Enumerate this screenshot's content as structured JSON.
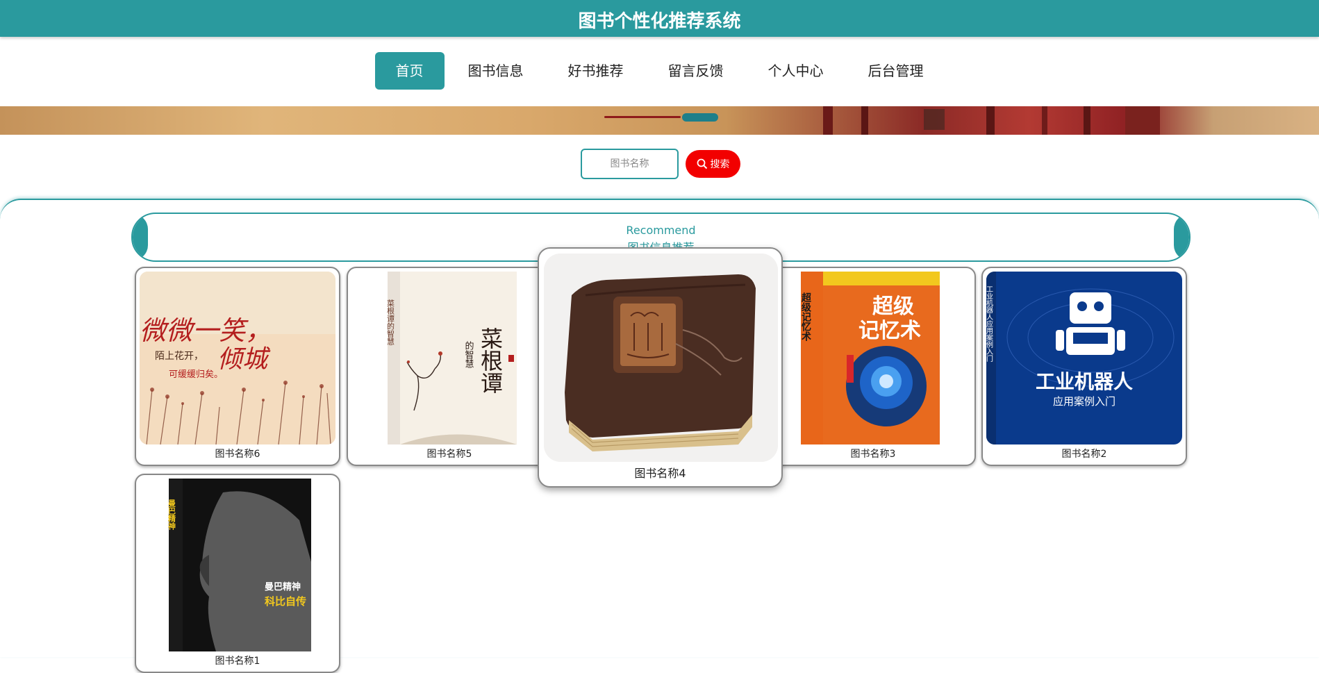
{
  "header": {
    "title": "图书个性化推荐系统"
  },
  "nav": {
    "items": [
      {
        "label": "首页",
        "active": true
      },
      {
        "label": "图书信息"
      },
      {
        "label": "好书推荐"
      },
      {
        "label": "留言反馈"
      },
      {
        "label": "个人中心"
      },
      {
        "label": "后台管理"
      }
    ]
  },
  "search": {
    "placeholder": "图书名称",
    "button_label": "搜索"
  },
  "recommend": {
    "title_en": "Recommend",
    "title_cn": "图书信息推荐"
  },
  "books": [
    {
      "name": "图书名称6"
    },
    {
      "name": "图书名称5"
    },
    {
      "name": "图书名称4"
    },
    {
      "name": "图书名称3"
    },
    {
      "name": "图书名称2"
    },
    {
      "name": "图书名称1"
    }
  ],
  "covers": {
    "book6": {
      "line1": "微微一笑，",
      "line2": "倾城",
      "line3": "陌上花开，",
      "line4": "可缓缓归矣。"
    },
    "book5": {
      "spine": "菜根谭的智慧",
      "title": "菜根谭",
      "subtitle": "的智慧"
    },
    "book3": {
      "title1": "超级",
      "title2": "记忆术",
      "spine": "超级记忆术"
    },
    "book2": {
      "title": "工业机器人",
      "subtitle": "应用案例入门",
      "spine": "工业机器人应用案例入门"
    },
    "book1": {
      "title": "曼巴精神",
      "subtitle": "科比自传"
    }
  },
  "colors": {
    "brand": "#2a9a9e",
    "search_button": "#f20000"
  }
}
